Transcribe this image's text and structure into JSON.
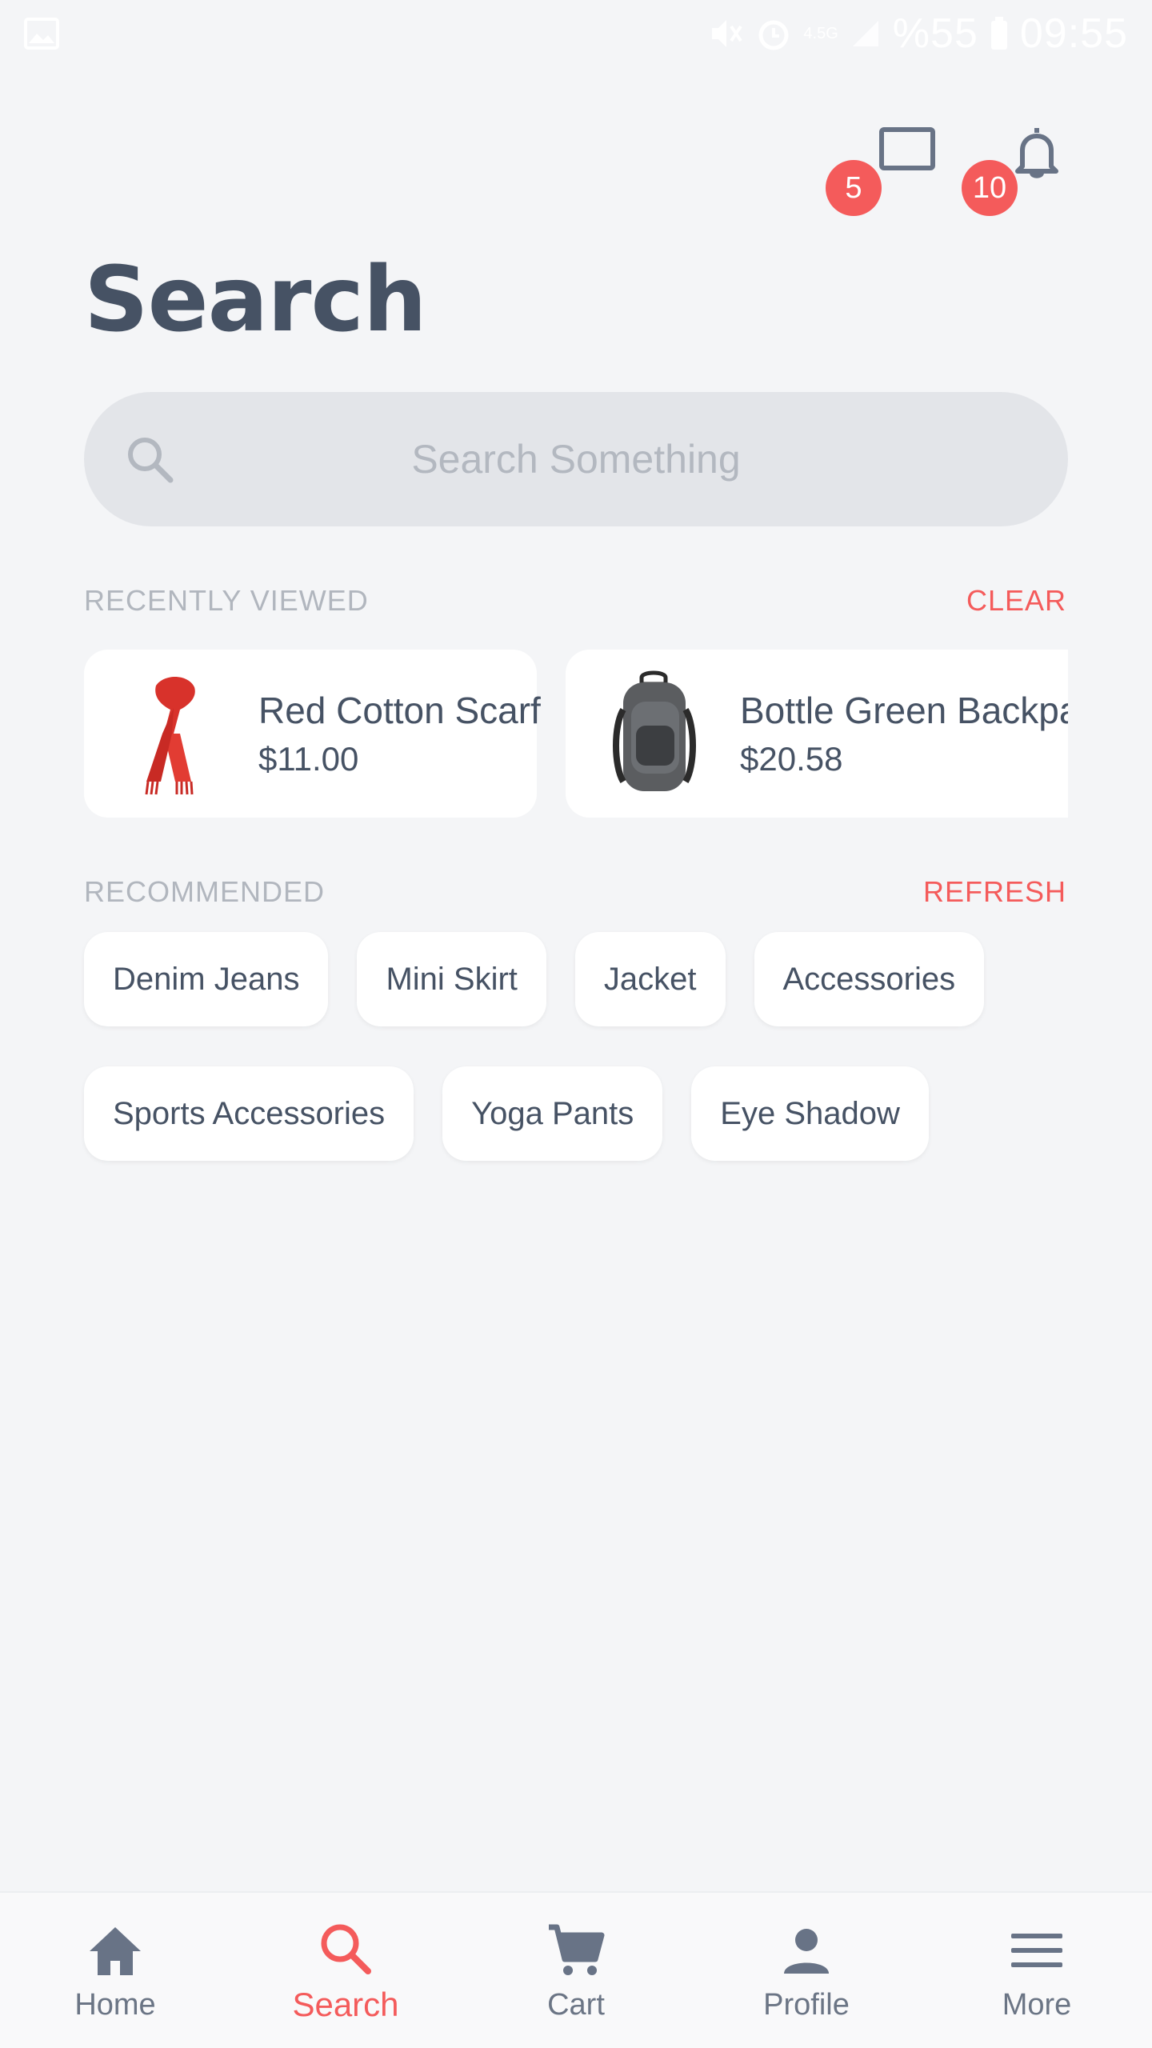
{
  "status_bar": {
    "network": "4.5G",
    "battery": "%55",
    "time": "09:55"
  },
  "header": {
    "messages_badge": "5",
    "notifications_badge": "10",
    "title": "Search"
  },
  "search": {
    "placeholder": "Search Something"
  },
  "recently_viewed": {
    "label": "RECENTLY VIEWED",
    "action": "CLEAR",
    "items": [
      {
        "name": "Red Cotton Scarf",
        "price": "$11.00"
      },
      {
        "name": "Bottle Green Backpack",
        "price": "$20.58"
      }
    ]
  },
  "recommended": {
    "label": "RECOMMENDED",
    "action": "REFRESH",
    "chips": [
      "Denim Jeans",
      "Mini Skirt",
      "Jacket",
      "Accessories",
      "Sports Accessories",
      "Yoga Pants",
      "Eye Shadow"
    ]
  },
  "bottom_nav": {
    "items": [
      {
        "label": "Home",
        "icon": "home-icon"
      },
      {
        "label": "Search",
        "icon": "search-icon"
      },
      {
        "label": "Cart",
        "icon": "cart-icon"
      },
      {
        "label": "Profile",
        "icon": "profile-icon"
      },
      {
        "label": "More",
        "icon": "menu-icon"
      }
    ],
    "active": "Search"
  },
  "colors": {
    "accent": "#f45b5b",
    "text": "#465264",
    "background": "#f4f5f7"
  }
}
